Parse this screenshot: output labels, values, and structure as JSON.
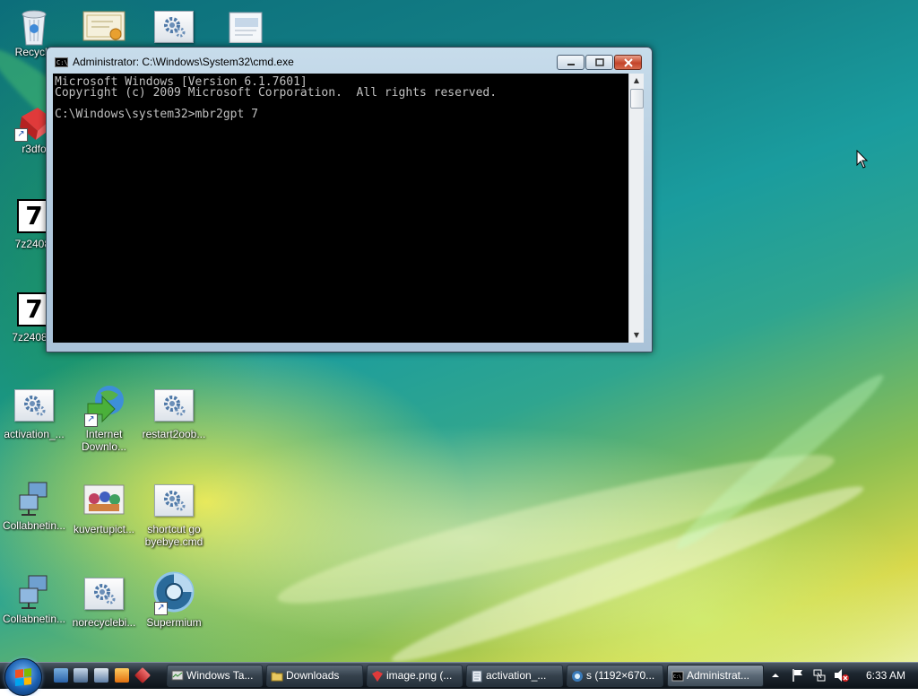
{
  "cmd_window": {
    "title": "Administrator: C:\\Windows\\System32\\cmd.exe",
    "console_lines": [
      "Microsoft Windows [Version 6.1.7601]",
      "Copyright (c) 2009 Microsoft Corporation.  All rights reserved.",
      "",
      "C:\\Windows\\system32>mbr2gpt 7"
    ]
  },
  "desktop_icons": [
    {
      "label": "Recycle",
      "icon": "recycle-bin-icon"
    },
    {
      "label": "",
      "icon": "certificate-icon"
    },
    {
      "label": "",
      "icon": "gear-script-icon"
    },
    {
      "label": "",
      "icon": "document-icon"
    },
    {
      "label": "r3dfo",
      "icon": "app-shortcut-icon"
    },
    {
      "label": "7z2408.",
      "icon": "7zip-icon"
    },
    {
      "label": "7z2408-x",
      "icon": "7zip-icon"
    },
    {
      "label": "activation_...",
      "icon": "gear-script-icon"
    },
    {
      "label": "Internet Downlo...",
      "icon": "internet-download-manager-icon"
    },
    {
      "label": "restart2oob...",
      "icon": "gear-script-icon"
    },
    {
      "label": "Collabnetin...",
      "icon": "network-computer-icon"
    },
    {
      "label": "kuvertupict...",
      "icon": "picture-icon"
    },
    {
      "label": "shortcut go byebye.cmd",
      "icon": "gear-script-icon"
    },
    {
      "label": "Collabnetin...",
      "icon": "network-computer-icon"
    },
    {
      "label": "norecyclebi...",
      "icon": "gear-script-icon"
    },
    {
      "label": "Supermium",
      "icon": "supermium-browser-icon"
    }
  ],
  "taskbar": {
    "buttons": [
      {
        "label": "Windows Ta...",
        "icon": "task-manager-icon",
        "active": false
      },
      {
        "label": "Downloads",
        "icon": "folder-icon",
        "active": false
      },
      {
        "label": "image.png (...",
        "icon": "image-editor-icon",
        "active": false
      },
      {
        "label": "activation_...",
        "icon": "notepad-icon",
        "active": false
      },
      {
        "label": "s (1192×670...",
        "icon": "browser-icon",
        "active": false
      },
      {
        "label": "Administrat...",
        "icon": "cmd-icon",
        "active": true
      }
    ],
    "clock": "6:33 AM"
  },
  "colors": {
    "console_bg": "#000000",
    "console_text": "#c0c0c0",
    "close_button": "#c4442a",
    "taskbar": "#1e2730"
  }
}
